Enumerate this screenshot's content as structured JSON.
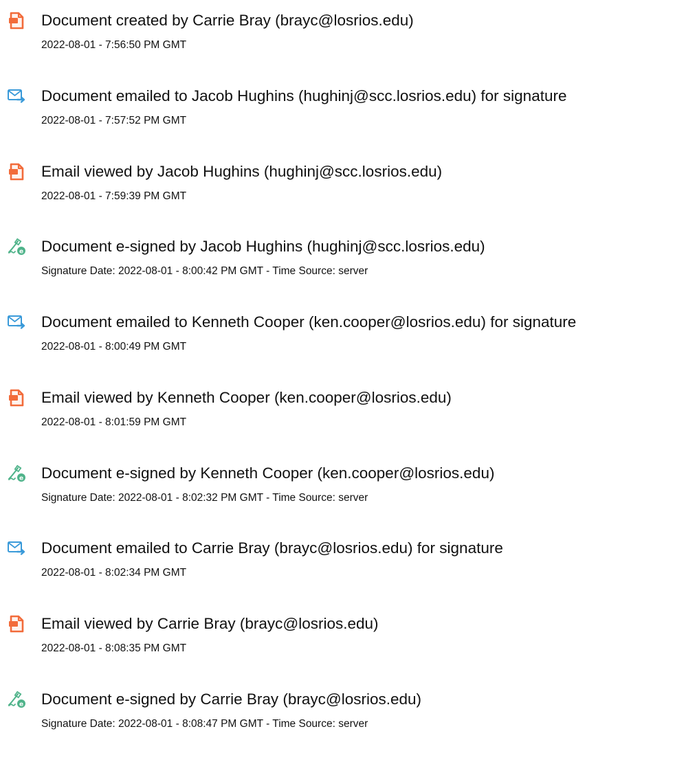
{
  "colors": {
    "created_icon": "#f26b3a",
    "email_icon": "#3a9ad9",
    "signed_icon": "#4fb38a",
    "text": "#111111"
  },
  "events": [
    {
      "icon": "document-icon",
      "title": "Document created by Carrie Bray (brayc@losrios.edu)",
      "date": "2022-08-01 - 7:56:50 PM GMT"
    },
    {
      "icon": "email-sent-icon",
      "title": "Document emailed to Jacob Hughins (hughinj@scc.losrios.edu) for signature",
      "date": "2022-08-01 - 7:57:52 PM GMT"
    },
    {
      "icon": "document-icon",
      "title": "Email viewed by Jacob Hughins (hughinj@scc.losrios.edu)",
      "date": "2022-08-01 - 7:59:39 PM GMT"
    },
    {
      "icon": "e-sign-icon",
      "title": "Document e-signed by Jacob Hughins (hughinj@scc.losrios.edu)",
      "date": "Signature Date: 2022-08-01 - 8:00:42 PM GMT - Time Source: server"
    },
    {
      "icon": "email-sent-icon",
      "title": "Document emailed to Kenneth Cooper (ken.cooper@losrios.edu) for signature",
      "date": "2022-08-01 - 8:00:49 PM GMT"
    },
    {
      "icon": "document-icon",
      "title": "Email viewed by Kenneth Cooper (ken.cooper@losrios.edu)",
      "date": "2022-08-01 - 8:01:59 PM GMT"
    },
    {
      "icon": "e-sign-icon",
      "title": "Document e-signed by Kenneth Cooper (ken.cooper@losrios.edu)",
      "date": "Signature Date: 2022-08-01 - 8:02:32 PM GMT - Time Source: server"
    },
    {
      "icon": "email-sent-icon",
      "title": "Document emailed to Carrie Bray (brayc@losrios.edu) for signature",
      "date": "2022-08-01 - 8:02:34 PM GMT"
    },
    {
      "icon": "document-icon",
      "title": "Email viewed by Carrie Bray (brayc@losrios.edu)",
      "date": "2022-08-01 - 8:08:35 PM GMT"
    },
    {
      "icon": "e-sign-icon",
      "title": "Document e-signed by Carrie Bray (brayc@losrios.edu)",
      "date": "Signature Date: 2022-08-01 - 8:08:47 PM GMT - Time Source: server"
    }
  ]
}
